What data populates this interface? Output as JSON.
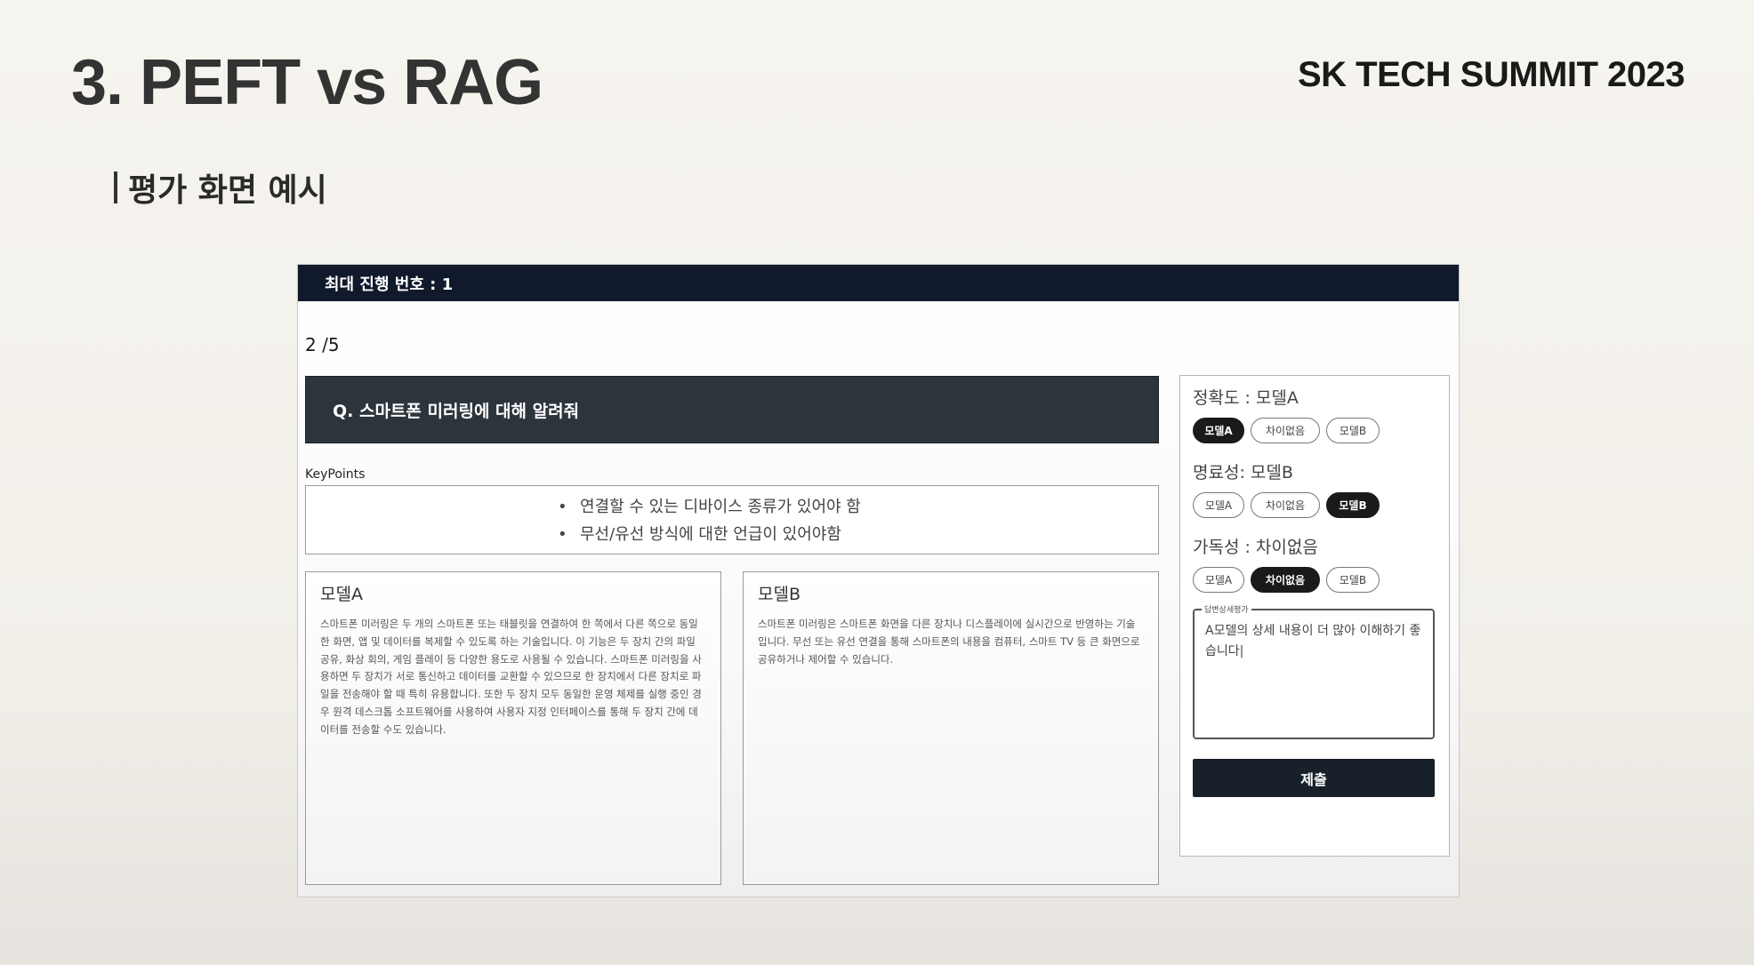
{
  "slide": {
    "title": "3. PEFT vs RAG",
    "brand": "SK TECH SUMMIT 2023",
    "subtitle": "평가 화면 예시"
  },
  "app": {
    "topbar": "최대 진행 번호 : 1",
    "progress": "2 /5",
    "question": "Q. 스마트폰 미러링에 대해 알려줘",
    "keypoints_label": "KeyPoints",
    "keypoints": [
      "연결할 수 있는 디바이스 종류가 있어야 함",
      "무선/유선 방식에 대한 언급이 있어야함"
    ],
    "model_a": {
      "name": "모델A",
      "answer": "스마트폰 미러링은 두 개의 스마트폰 또는 태블릿을 연결하여 한 쪽에서 다른 쪽으로 동일한 화면, 앱 및 데이터를 복제할 수 있도록 하는 기술입니다. 이 기능은 두 장치 간의 파일 공유, 화상 회의, 게임 플레이 등 다양한 용도로 사용될 수 있습니다. 스마트폰 미러링을 사용하면 두 장치가 서로 통신하고 데이터를 교환할 수 있으므로 한 장치에서 다른 장치로 파일을 전송해야 할 때 특히 유용합니다. 또한 두 장치 모두 동일한 운영 체제를 실행 중인 경우 원격 데스크톱 소프트웨어를 사용하여 사용자 지정 인터페이스를 통해 두 장치 간에 데이터를 전송할 수도 있습니다."
    },
    "model_b": {
      "name": "모델B",
      "answer": "스마트폰 미러링은 스마트폰 화면을 다른 장치나 디스플레이에 실시간으로 반영하는 기술입니다. 무선 또는 유선 연결을 통해 스마트폰의 내용을 컴퓨터, 스마트 TV 등 큰 화면으로 공유하거나 제어할 수 있습니다."
    },
    "criteria": [
      {
        "label": "정확도 : 모델A",
        "options": [
          "모델A",
          "차이없음",
          "모델B"
        ],
        "selected": 0
      },
      {
        "label": "명료성: 모델B",
        "options": [
          "모델A",
          "차이없음",
          "모델B"
        ],
        "selected": 2
      },
      {
        "label": "가독성 : 차이없음",
        "options": [
          "모델A",
          "차이없음",
          "모델B"
        ],
        "selected": 1
      }
    ],
    "detail_legend": "답변상세평가",
    "detail_text": "A모델의 상세 내용이 더 많아 이해하기 좋습니다|",
    "submit": "제출"
  }
}
